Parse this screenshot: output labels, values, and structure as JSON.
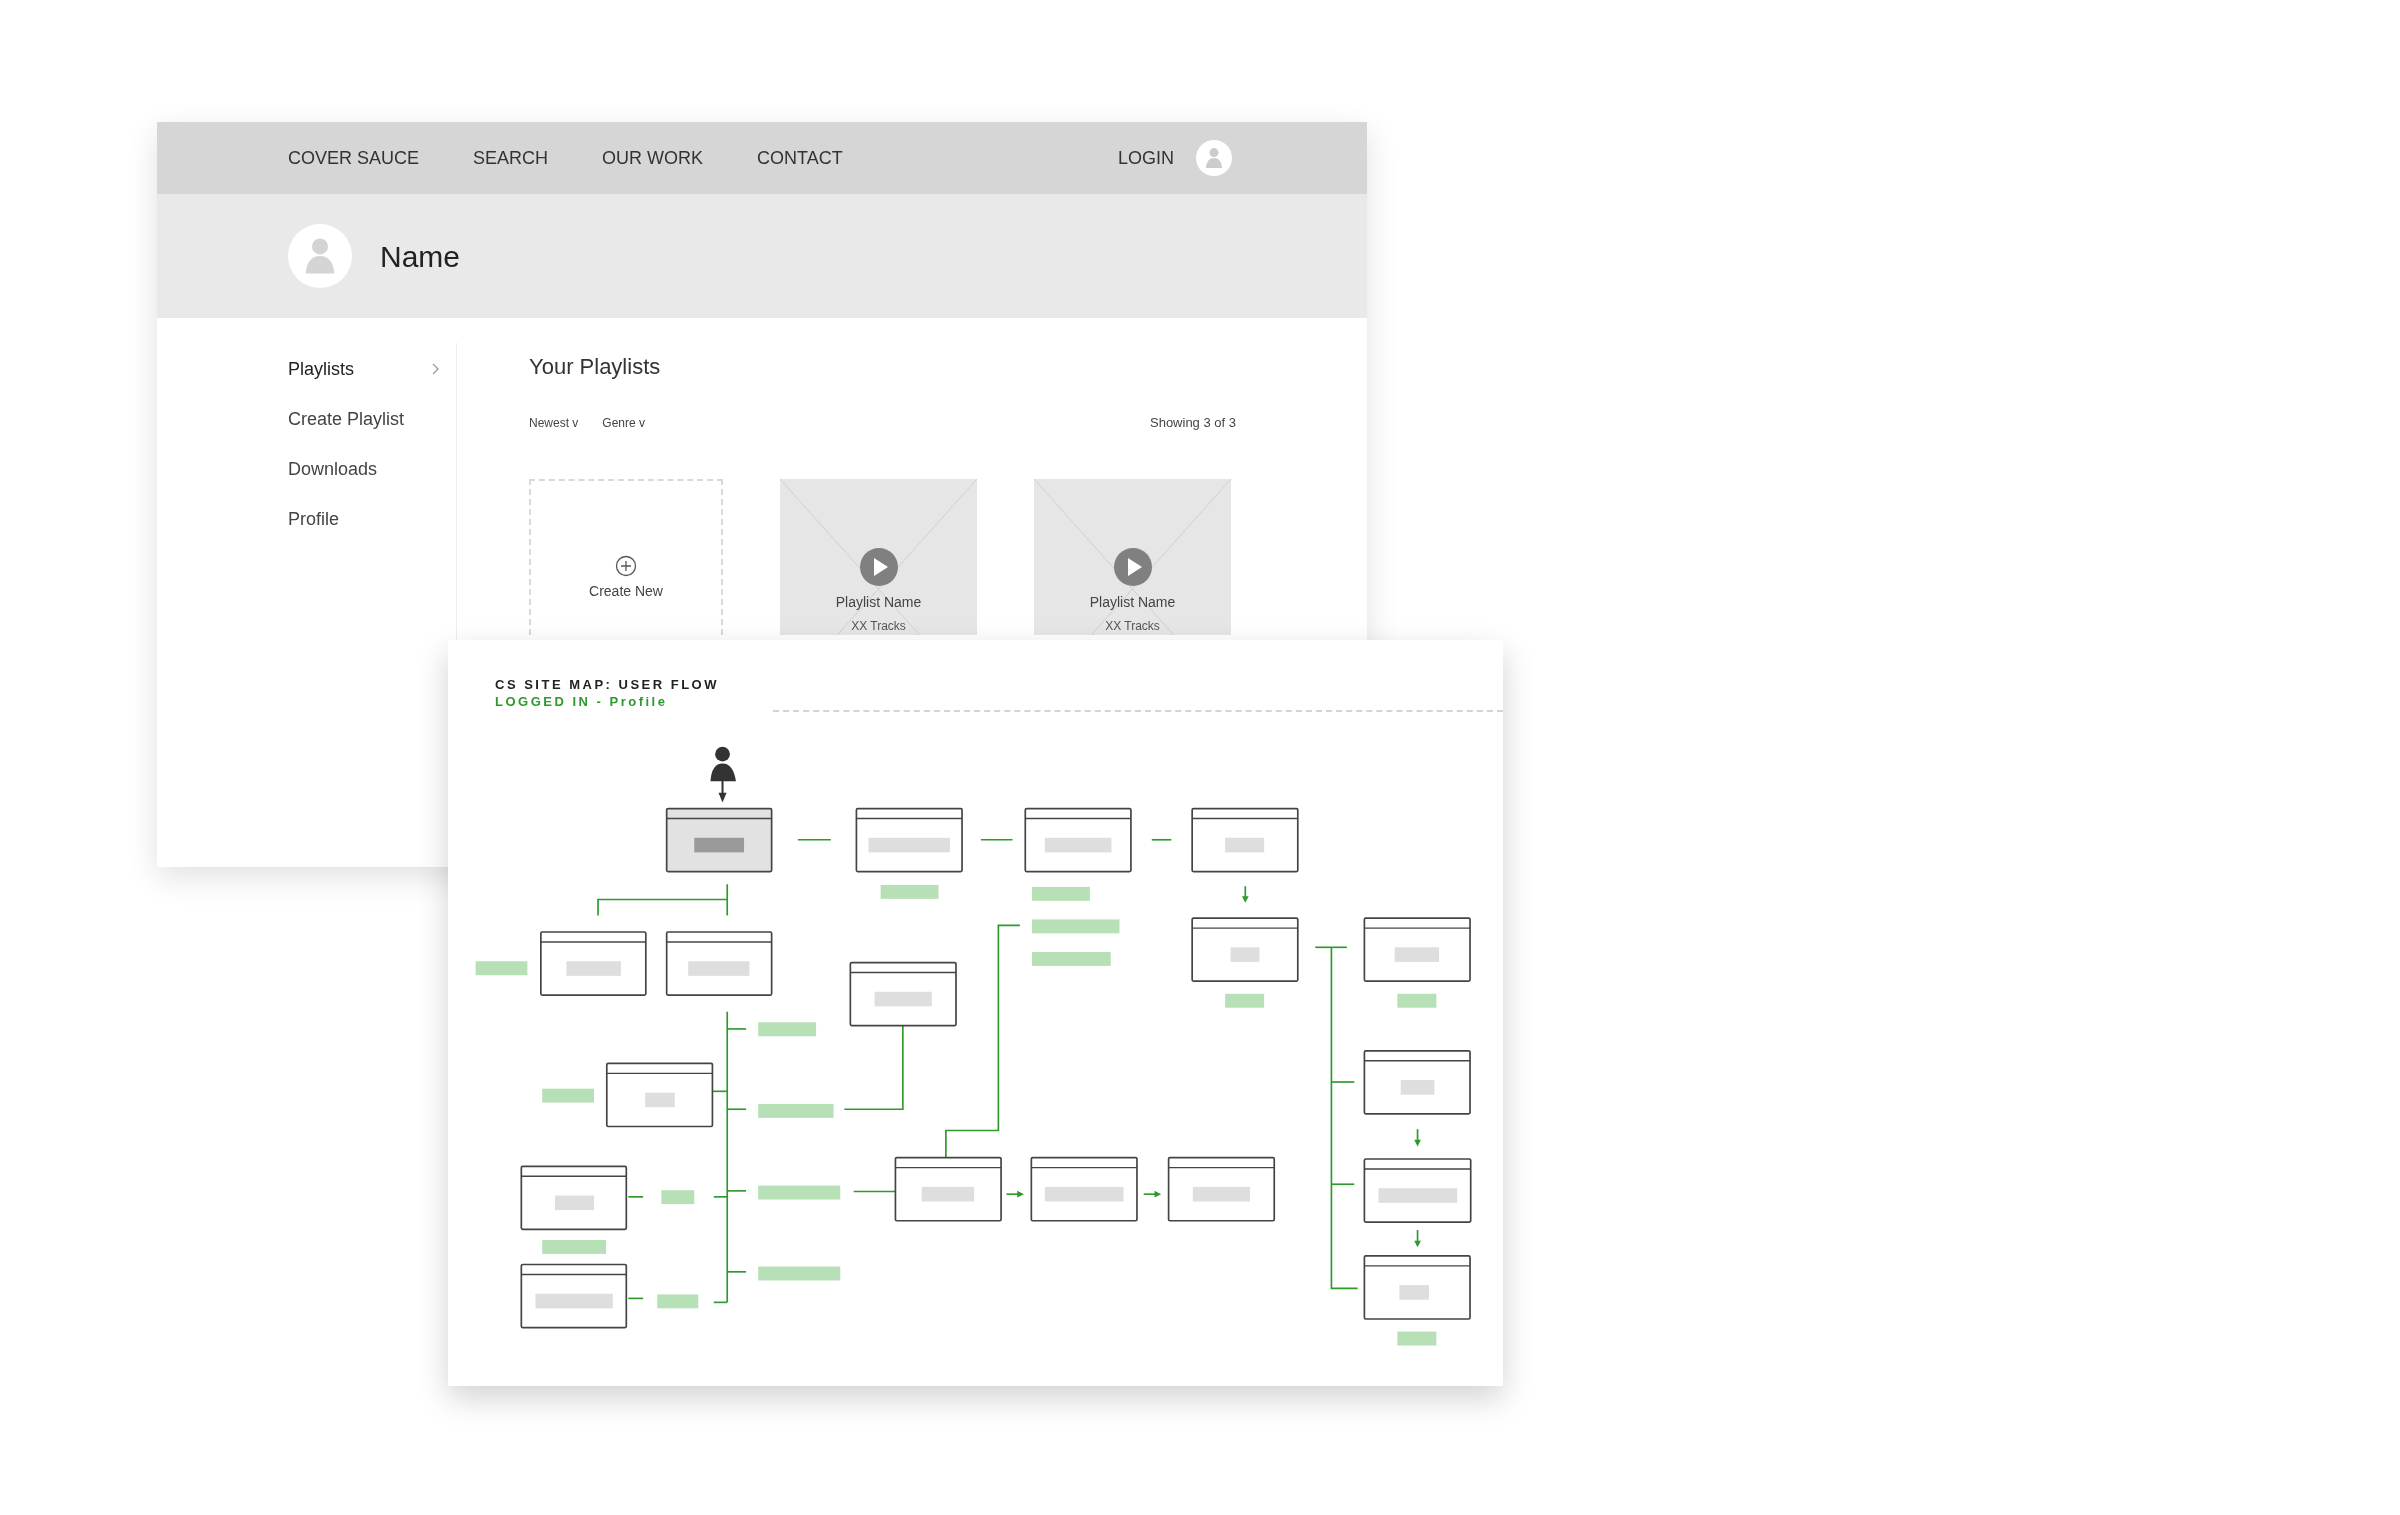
{
  "nav": {
    "items": [
      {
        "label": "COVER SAUCE"
      },
      {
        "label": "SEARCH"
      },
      {
        "label": "OUR WORK"
      },
      {
        "label": "CONTACT"
      }
    ],
    "login": "LOGIN"
  },
  "profile": {
    "name": "Name"
  },
  "sidebar": {
    "items": [
      {
        "label": "Playlists",
        "selected": true
      },
      {
        "label": "Create Playlist",
        "selected": false
      },
      {
        "label": "Downloads",
        "selected": false
      },
      {
        "label": "Profile",
        "selected": false
      }
    ]
  },
  "content": {
    "title": "Your Playlists",
    "filters": [
      {
        "label": "Newest",
        "caret": "v"
      },
      {
        "label": "Genre",
        "caret": "v"
      }
    ],
    "count": "Showing 3 of 3",
    "cards": [
      {
        "kind": "create",
        "label": "Create New"
      },
      {
        "kind": "playlist",
        "name": "Playlist Name",
        "tracks": "XX Tracks"
      },
      {
        "kind": "playlist",
        "name": "Playlist Name",
        "tracks": "XX Tracks"
      }
    ]
  },
  "site_map": {
    "title": "CS SITE MAP: USER FLOW",
    "subtitle": "LOGGED IN - Profile"
  }
}
